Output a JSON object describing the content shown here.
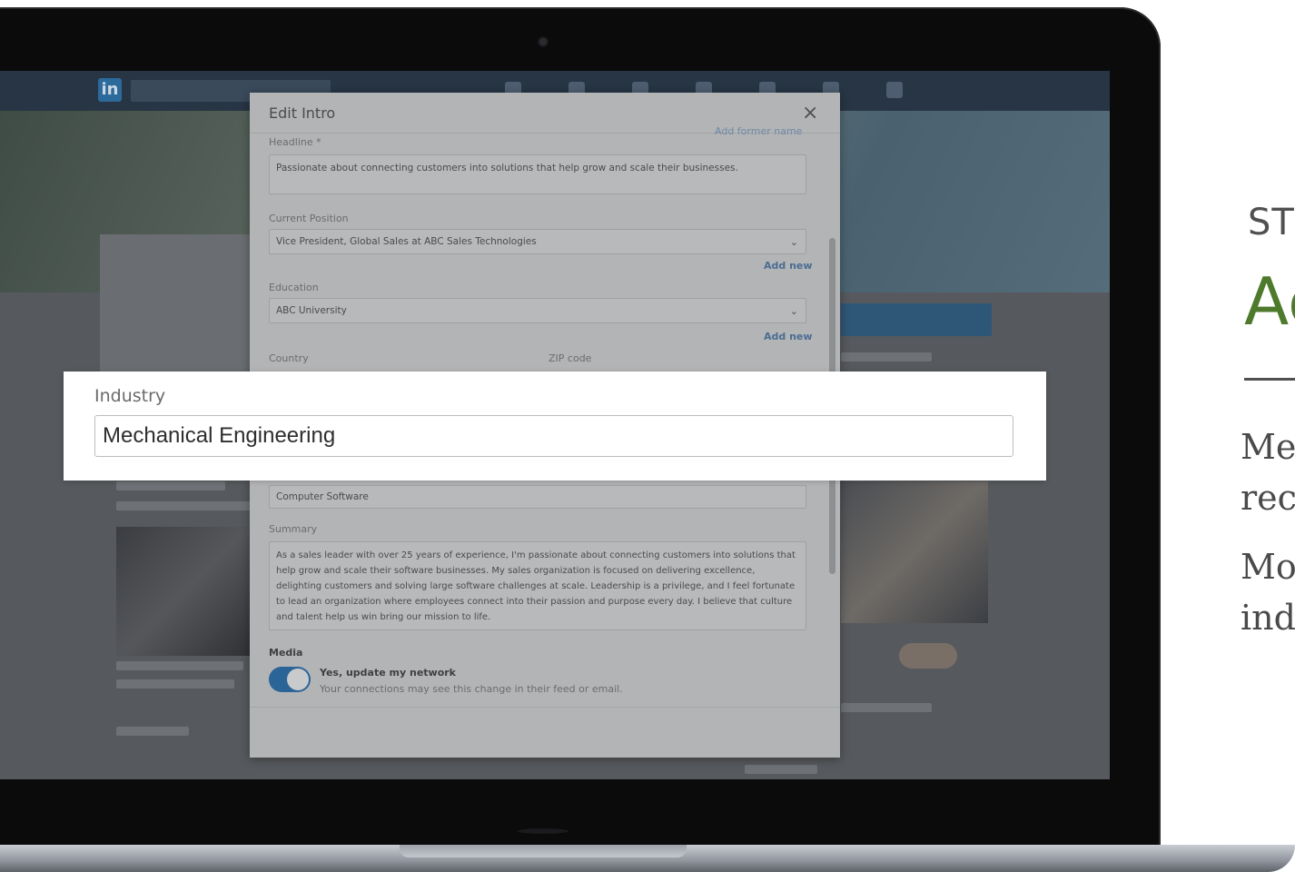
{
  "slide": {
    "step_label": "ST",
    "title": "Ac",
    "body_lines": [
      "Me",
      "rec",
      "Mo",
      "ind"
    ]
  },
  "highlight": {
    "label": "Industry",
    "value": "Mechanical Engineering"
  },
  "modal": {
    "title": "Edit Intro",
    "close_glyph": "×",
    "former_name_link": "Add former name",
    "headline_label": "Headline *",
    "headline_value": "Passionate about connecting customers into solutions that help grow and scale their businesses.",
    "position_label": "Current Position",
    "position_value": "Vice President, Global Sales at ABC Sales Technologies",
    "add_new_1": "Add new",
    "education_label": "Education",
    "education_value": "ABC University",
    "add_new_2": "Add new",
    "country_label": "Country",
    "zip_label": "ZIP code",
    "industry_value": "Computer Software",
    "summary_label": "Summary",
    "summary_value": "As a sales leader with over 25 years of experience, I'm passionate about connecting customers into solutions that help grow and scale their software businesses. My sales organization is focused on delivering excellence, delighting customers and solving large software challenges at scale. Leadership is a privilege, and I feel fortunate to lead an organization where employees connect into their passion and purpose every day. I believe that culture and talent help us win bring our mission to life.",
    "media_label": "Media",
    "toggle_title": "Yes, update my network",
    "toggle_sub": "Your connections may see this change in their feed or email.",
    "toggle_on": true
  },
  "background": {
    "logo_text": "in",
    "colors": {
      "topbar": "#273544",
      "accent": "#2b6497",
      "title_green": "#4e7a2c"
    }
  }
}
